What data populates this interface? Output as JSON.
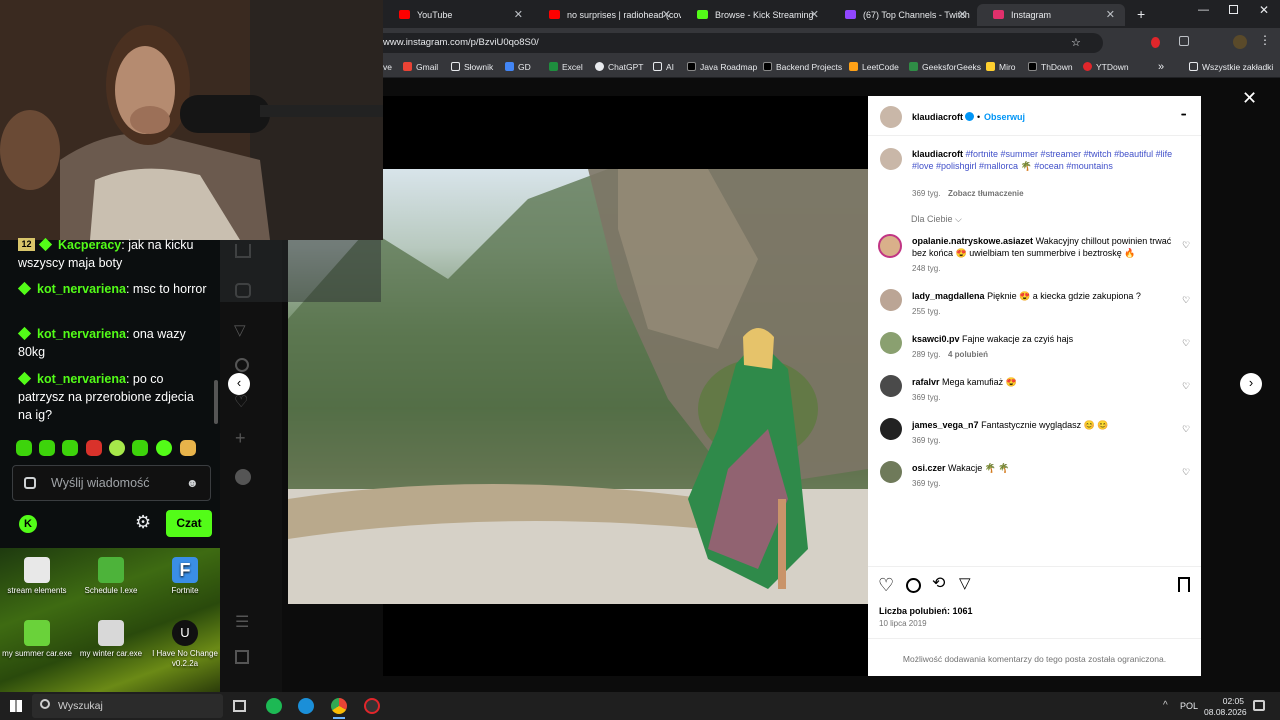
{
  "browser": {
    "tabs": [
      {
        "title": "YouTube",
        "color": "#ff0000"
      },
      {
        "title": "no surprises | radiohead (cov",
        "color": "#ff0000"
      },
      {
        "title": "Browse - Kick Streaming",
        "color": "#53fc18"
      },
      {
        "title": "(67) Top Channels - Twitch",
        "color": "#9146ff"
      },
      {
        "title": "Instagram",
        "color": "#e1306c"
      }
    ],
    "new_tab": "+",
    "url": "www.instagram.com/p/BzviU0qo8S0/",
    "bookmarks": [
      "ve",
      "Gmail",
      "Słownik",
      "GD",
      "Excel",
      "ChatGPT",
      "AI",
      "Java Roadmap",
      "Backend Projects",
      "LeetCode",
      "GeeksforGeeks",
      "Miro",
      "ThDown",
      "YTDown"
    ],
    "bookmarks_more": "»",
    "all_bookmarks": "Wszystkie zakładki"
  },
  "chat": {
    "messages": [
      {
        "badge": "12",
        "user": "Kacperacy",
        "text": ": jak na kicku wszyscy maja boty"
      },
      {
        "user": "kot_nervariena",
        "text": ": msc to horror"
      },
      {
        "user": "kot_nervariena",
        "text": ": ona wazy 80kg"
      },
      {
        "user": "kot_nervariena",
        "text": ": po co patrzysz na przerobione zdjecia na ig?"
      }
    ],
    "input_placeholder": "Wyślij wiadomość",
    "send_label": "Czat"
  },
  "desktop_icons": [
    {
      "label": "stream elements"
    },
    {
      "label": "Schedule I.exe"
    },
    {
      "label": "Fortnite"
    },
    {
      "label": "my summer car.exe"
    },
    {
      "label": "my winter car.exe"
    },
    {
      "label": "I Have No Change v0.2.2a"
    }
  ],
  "post": {
    "author": "klaudiacroft",
    "follow": "Obserwuj",
    "dot": "•",
    "more": "•••",
    "caption_hashtags": "#fortnite #summer #streamer #twitch #beautiful #life #love #polishgirl #mallorca 🌴 #ocean #mountains",
    "caption_time": "369 tyg.",
    "translate": "Zobacz tłumaczenie",
    "for_you": "Dla Ciebie",
    "comments": [
      {
        "user": "opalanie.natryskowe.asiazet",
        "text": "Wakacyjny chillout powinien trwać bez końca 😍 uwielbiam ten summerbive i beztroskę 🔥",
        "time": "248 tyg.",
        "likes": ""
      },
      {
        "user": "lady_magdallena",
        "text": "Pięknie 😍 a kiecka gdzie zakupiona ?",
        "time": "255 tyg.",
        "likes": ""
      },
      {
        "user": "ksawci0.pv",
        "text": "Fajne wakacje za czyiś hajs",
        "time": "289 tyg.",
        "likes": "4 polubień"
      },
      {
        "user": "rafalvr",
        "text": "Mega kamufiaż 😍",
        "time": "369 tyg.",
        "likes": ""
      },
      {
        "user": "james_vega_n7",
        "text": "Fantastycznie wyglądasz 😊 😊",
        "time": "369 tyg.",
        "likes": ""
      },
      {
        "user": "osi.czer",
        "text": "Wakacje 🌴 🌴",
        "time": "369 tyg.",
        "likes": ""
      }
    ],
    "likes": "Liczba polubień: 1061",
    "date": "10 lipca 2019",
    "comments_limited": "Możliwość dodawania komentarzy do tego posta została ograniczona."
  },
  "taskbar": {
    "search_placeholder": "Wyszukaj",
    "lang": "POL",
    "time": "02:05",
    "date": "08.08.2026"
  },
  "colors": {
    "kick_green": "#53fc18",
    "ig_blue": "#0095f6",
    "hashtag": "#4150c9"
  }
}
